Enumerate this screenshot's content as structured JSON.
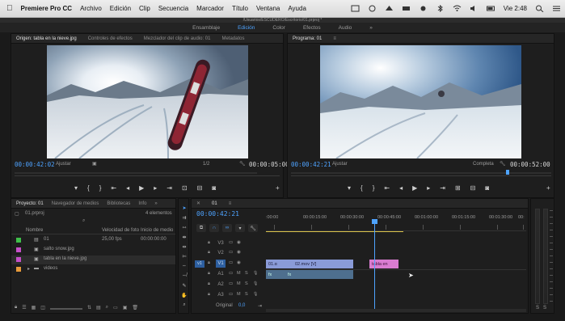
{
  "menubar": {
    "apple": "",
    "app_name": "Premiere Pro CC",
    "items": [
      "Archivo",
      "Edición",
      "Clip",
      "Secuencia",
      "Marcador",
      "Título",
      "Ventana",
      "Ayuda"
    ],
    "clock": "Vie 2:48"
  },
  "window": {
    "title": "/Usuarios/ESCUDERO/Escritorio/01.prproj *"
  },
  "workspaces": [
    "Ensamblaje",
    "Edición",
    "Color",
    "Efectos",
    "Audio"
  ],
  "workspace_active": "Edición",
  "workspace_more": "»",
  "source": {
    "tabs": [
      "Origen: tabla en la nieve.jpg",
      "Controles de efectos",
      "Mezclador del clip de audio: 01",
      "Metadatos"
    ],
    "timecode_left": "00:00:42:02",
    "fit_label": "Ajustar",
    "fraction": "1/2",
    "timecode_right": "00:00:05:00"
  },
  "program": {
    "tab": "Programa: 01",
    "timecode_left": "00:00:42:21",
    "fit_label": "Ajustar",
    "quality": "Completa",
    "timecode_right": "00:00:52:00"
  },
  "project": {
    "tabs": [
      "Proyecto: 01",
      "Navegador de medios",
      "Bibliotecas",
      "Info"
    ],
    "more": "»",
    "file": "01.prproj",
    "count": "4 elementos",
    "columns": [
      "Nombre",
      "Velocidad de fotograma",
      "Inicio de medio"
    ],
    "col_short": [
      "Nombre",
      "Velocidad de foto",
      "Inicio de medio"
    ],
    "rows": [
      {
        "name": "01",
        "fps": "25,00 fps",
        "start": "00:00:00:00",
        "color": "#3fbf4a"
      },
      {
        "name": "salto snow.jpg",
        "fps": "",
        "start": "",
        "color": "#c64fc8"
      },
      {
        "name": "tabla en la nieve.jpg",
        "fps": "",
        "start": "",
        "color": "#c64fc8"
      },
      {
        "name": "videos",
        "fps": "",
        "start": "",
        "color": "#e79a3a"
      }
    ]
  },
  "timeline": {
    "tab": "01",
    "timecode": "00:00:42:21",
    "ruler": [
      ":00:00",
      "00:00:15:00",
      "00:00:30:00",
      "00:00:45:00",
      "00:01:00:00",
      "00:01:15:00",
      "00:01:30:00",
      "00:"
    ],
    "video_tracks": [
      "V3",
      "V2",
      "V1"
    ],
    "audio_tracks": [
      "A1",
      "A2",
      "A3"
    ],
    "master_label": "Original",
    "master_value": "0,0",
    "clips": {
      "v1a": "01.ɑ",
      "v1b": "02.mov [V]",
      "v1c": "tabla en",
      "a1a": "fx",
      "a1b": "fx"
    },
    "track_letters": {
      "m": "M",
      "s": "S"
    }
  },
  "meter": {
    "labels": [
      "S",
      "S"
    ]
  },
  "colors": {
    "accent": "#4ea3ff",
    "video_clip": "#8a9bd8",
    "audio_clip": "#4e6f8e",
    "image_clip": "#d97cd0",
    "playhead": "#4ea3ff"
  },
  "icons": [
    "apple-icon",
    "wifi-icon",
    "battery-icon",
    "search-icon",
    "marker-icon",
    "play-icon",
    "step-back-icon",
    "step-forward-icon",
    "wrench-icon",
    "plus-icon",
    "lock-icon",
    "eye-icon",
    "selection-tool-icon",
    "razor-tool-icon",
    "hand-tool-icon",
    "zoom-tool-icon"
  ]
}
